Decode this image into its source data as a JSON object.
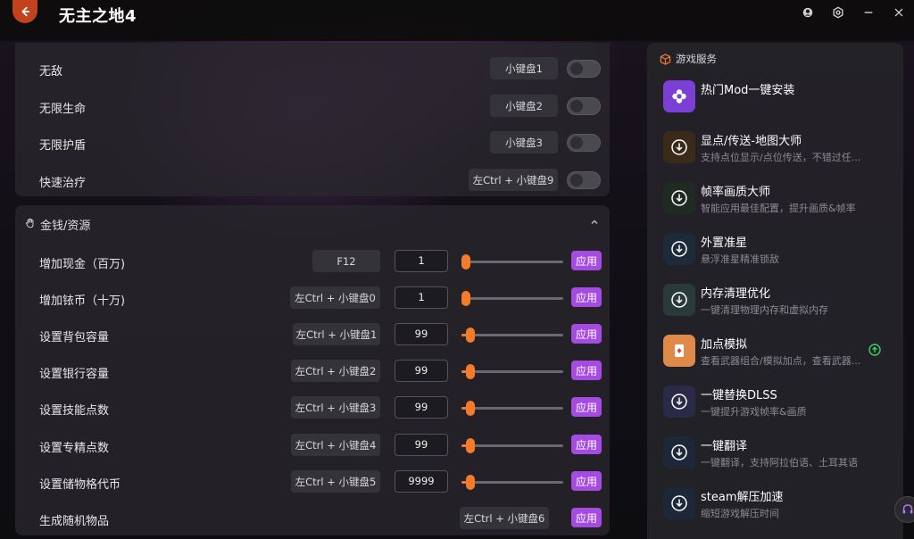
{
  "app": {
    "title": "无主之地4",
    "accent": "#a54be0",
    "slider_color": "#f07a2a"
  },
  "top_panel": {
    "rows": [
      {
        "label": "无敌",
        "hotkey": "小键盘1",
        "enabled": false
      },
      {
        "label": "无限生命",
        "hotkey": "小键盘2",
        "enabled": false
      },
      {
        "label": "无限护盾",
        "hotkey": "小键盘3",
        "enabled": false
      },
      {
        "label": "快速治疗",
        "hotkey": "左Ctrl + 小键盘9",
        "enabled": false
      }
    ]
  },
  "money_section": {
    "title": "金钱/资源",
    "apply_label": "应用",
    "rows": [
      {
        "label": "增加现金（百万)",
        "hotkey": "F12",
        "value": "1",
        "level": 0.0
      },
      {
        "label": "增加铱币（十万)",
        "hotkey": "左Ctrl + 小键盘0",
        "value": "1",
        "level": 0.0
      },
      {
        "label": "设置背包容量",
        "hotkey": "左Ctrl + 小键盘1",
        "value": "99",
        "level": 0.05
      },
      {
        "label": "设置银行容量",
        "hotkey": "左Ctrl + 小键盘2",
        "value": "99",
        "level": 0.05
      },
      {
        "label": "设置技能点数",
        "hotkey": "左Ctrl + 小键盘3",
        "value": "99",
        "level": 0.05
      },
      {
        "label": "设置专精点数",
        "hotkey": "左Ctrl + 小键盘4",
        "value": "99",
        "level": 0.05
      },
      {
        "label": "设置储物格代币",
        "hotkey": "左Ctrl + 小键盘5",
        "value": "9999",
        "level": 0.05
      }
    ],
    "last_row": {
      "label": "生成随机物品",
      "hotkey": "左Ctrl + 小键盘6"
    }
  },
  "sidebar": {
    "header": "游戏服务",
    "items": [
      {
        "title": "热门Mod一键安装",
        "desc": "",
        "icon": "flower-icon",
        "color": "#7b3fd6"
      },
      {
        "title": "显点/传送-地图大师",
        "desc": "支持点位显示/点位传送，不错过任...",
        "icon": "download-icon",
        "color": "#3a2a1a"
      },
      {
        "title": "帧率画质大师",
        "desc": "智能应用最佳配置，提升画质&帧率",
        "icon": "download-icon",
        "color": "#1e2a22"
      },
      {
        "title": "外置准星",
        "desc": "悬浮准星精准锁敌",
        "icon": "download-icon",
        "color": "#1c2a3a"
      },
      {
        "title": "内存清理优化",
        "desc": "一键清理物理内存和虚拟内存",
        "icon": "download-icon",
        "color": "#2a3a3a"
      },
      {
        "title": "加点模拟",
        "desc": "查看武器组合/模拟加点，查看武器...",
        "icon": "card-icon",
        "color": "#e08a4a"
      },
      {
        "title": "一键替换DLSS",
        "desc": "一键提升游戏帧率&画质",
        "icon": "download-icon",
        "color": "#2a2a48"
      },
      {
        "title": "一键翻译",
        "desc": "一键翻译，支持阿拉伯语、土耳其语",
        "icon": "download-icon",
        "color": "#1c2838"
      },
      {
        "title": "steam解压加速",
        "desc": "缩短游戏解压时间",
        "icon": "download-icon",
        "color": "#1c2838"
      }
    ]
  }
}
